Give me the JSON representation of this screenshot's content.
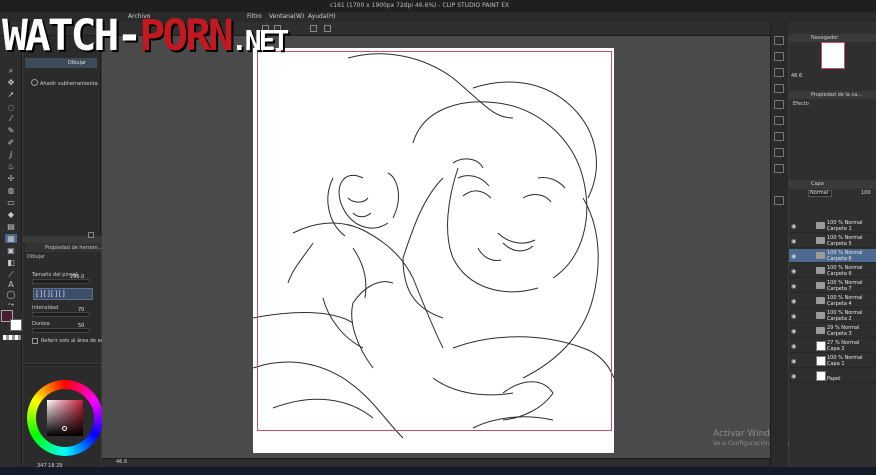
{
  "window": {
    "title": "c161 (1700 x 1900px 72dpi 46.6%)  - CLIP STUDIO PAINT EX"
  },
  "menu": {
    "items": [
      "Archivo",
      "Filtro",
      "Ventana(W)",
      "Ayuda(H)"
    ]
  },
  "watermark": {
    "part_a": "WATCH-",
    "part_b": "PORN",
    "part_c": ".NET"
  },
  "subtool": {
    "tab_label": "Dibujar",
    "add_label": "Añadir subherramienta"
  },
  "tool_property": {
    "title": "Propiedad de herram...",
    "subtitle": "Dibujar",
    "size_label": "Tamaño del pincel",
    "size_value": "296.0",
    "intensity_label": "Intensidad",
    "intensity_value": "70",
    "hardness_label": "Dureza",
    "hardness_value": "50",
    "brush_shapes": "[][][][]",
    "edit_only_label": "Referir solo al área de edición"
  },
  "color": {
    "foreground": "#4b1b2e",
    "background": "#ffffff",
    "values": "347  18  29"
  },
  "status": {
    "zoom": "46.6"
  },
  "navigator": {
    "title": "Navegador",
    "zoom": "46.6"
  },
  "layer_property": {
    "title": "Propiedad de la ca...",
    "effect_label": "Efecto"
  },
  "layers_panel": {
    "title": "Capa",
    "blend_mode": "Normal",
    "opacity": "100",
    "layers": [
      {
        "mode": "100 % Normal",
        "name": "Carpeta 1",
        "kind": "folder"
      },
      {
        "mode": "100 % Normal",
        "name": "Carpeta 5",
        "kind": "folder"
      },
      {
        "mode": "100 % Normal",
        "name": "Carpeta 6",
        "kind": "folder",
        "selected": true
      },
      {
        "mode": "100 % Normal",
        "name": "Carpeta 6",
        "kind": "folder"
      },
      {
        "mode": "100 % Normal",
        "name": "Carpeta 7",
        "kind": "folder"
      },
      {
        "mode": "100 % Normal",
        "name": "Carpeta 4",
        "kind": "folder"
      },
      {
        "mode": "100 % Normal",
        "name": "Carpeta 2",
        "kind": "folder"
      },
      {
        "mode": "29 % Normal",
        "name": "Carpeta 3",
        "kind": "folder"
      },
      {
        "mode": "27 % Normal",
        "name": "Capa 2",
        "kind": "layer"
      },
      {
        "mode": "100 % Normal",
        "name": "Capa 1",
        "kind": "layer"
      },
      {
        "mode": "",
        "name": "Papel",
        "kind": "paper"
      }
    ]
  },
  "windows_notice": {
    "title": "Activar Windows",
    "subtitle": "Ve a Configuración para activar Windows."
  }
}
